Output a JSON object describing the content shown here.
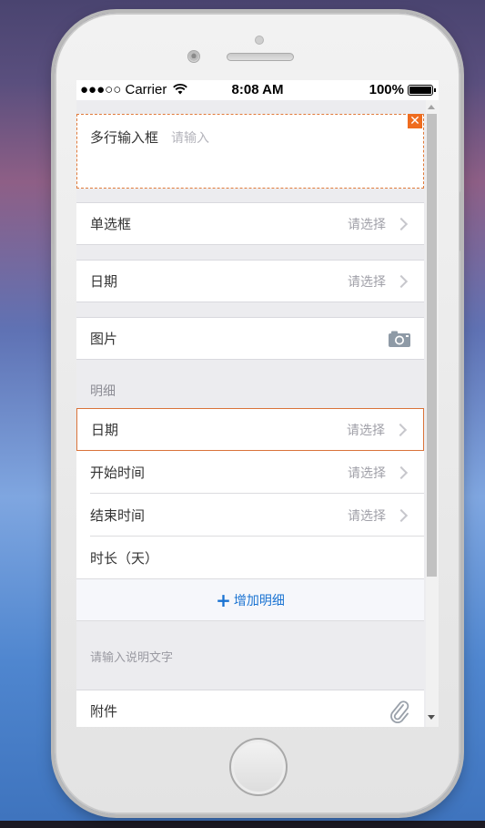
{
  "status_bar": {
    "signal": "●●●○○",
    "carrier": "Carrier",
    "time": "8:08 AM",
    "battery": "100%",
    "battery_level": 1.0
  },
  "form": {
    "textarea": {
      "label": "多行输入框",
      "placeholder": "请输入"
    },
    "radio": {
      "label": "单选框",
      "value": "请选择"
    },
    "date": {
      "label": "日期",
      "value": "请选择"
    },
    "image": {
      "label": "图片",
      "icon": "camera-icon"
    }
  },
  "details": {
    "title": "明细",
    "rows": [
      {
        "label": "日期",
        "value": "请选择"
      },
      {
        "label": "开始时间",
        "value": "请选择"
      },
      {
        "label": "结束时间",
        "value": "请选择"
      },
      {
        "label": "时长（天）",
        "value": ""
      }
    ],
    "add_label": "增加明细",
    "add_icon": "+"
  },
  "note_placeholder": "请输入说明文字",
  "attachment": {
    "label": "附件",
    "icon": "paperclip-icon"
  },
  "close_symbol": "✕",
  "colors": {
    "accent": "#1a73d2",
    "highlight": "#d9733a",
    "close": "#ef6c1f"
  }
}
